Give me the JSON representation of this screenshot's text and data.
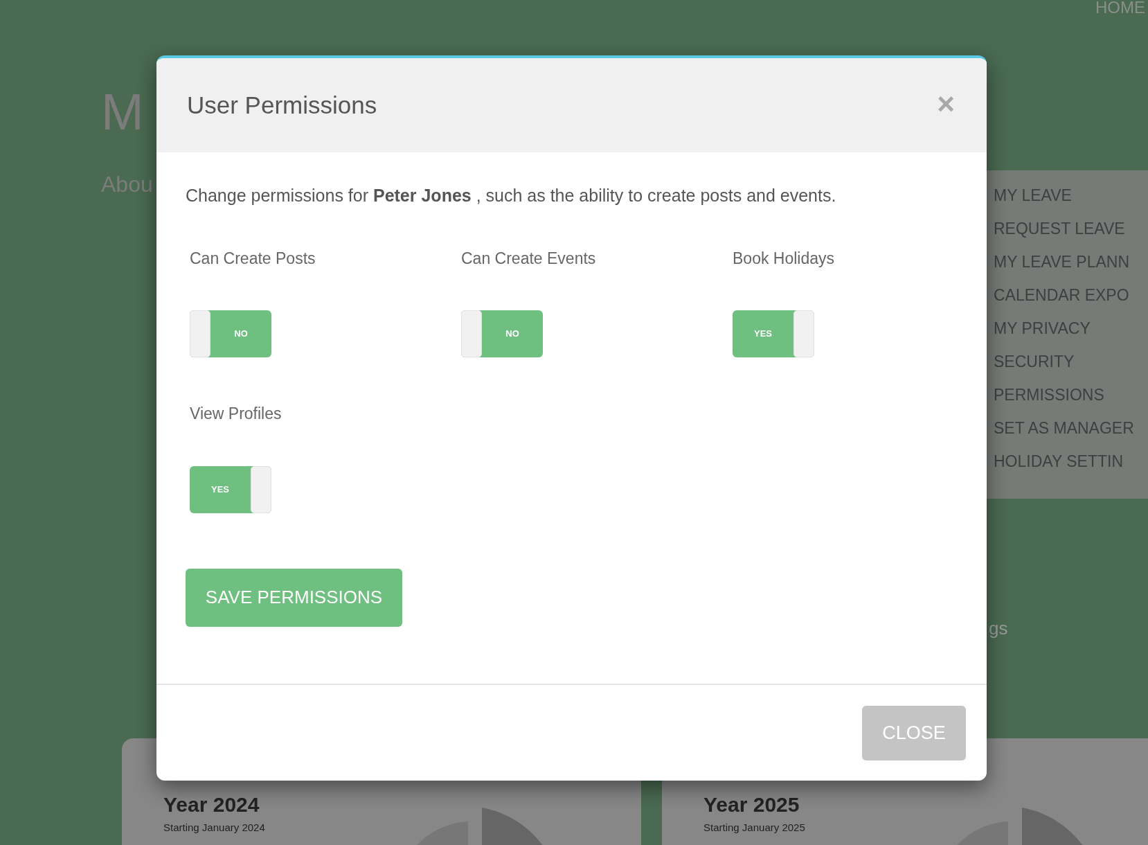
{
  "page": {
    "nav_link": "HOME",
    "heading": "M",
    "subheading": "Abou",
    "partial_text": "gs",
    "sidebar": {
      "items": [
        {
          "label": "MY LEAVE"
        },
        {
          "label": "REQUEST LEAVE"
        },
        {
          "label": "MY LEAVE PLANN"
        },
        {
          "label": "CALENDAR EXPO"
        },
        {
          "label": "MY PRIVACY"
        },
        {
          "label": "SECURITY"
        },
        {
          "label": "PERMISSIONS"
        },
        {
          "label": "SET AS MANAGER"
        },
        {
          "label": "HOLIDAY SETTIN"
        }
      ]
    },
    "cards": [
      {
        "title": "Year 2024",
        "subtitle": "Starting January 2024"
      },
      {
        "title": "Year 2025",
        "subtitle": "Starting January 2025"
      }
    ]
  },
  "modal": {
    "title": "User Permissions",
    "close_icon": "×",
    "description": "Change permissions for **Peter Jones** , such as the ability to create posts and events.",
    "permissions": [
      {
        "label": "Can Create Posts",
        "on": false,
        "text": "NO"
      },
      {
        "label": "Can Create Events",
        "on": false,
        "text": "NO"
      },
      {
        "label": "Book Holidays",
        "on": true,
        "text": "YES"
      },
      {
        "label": "View Profiles",
        "on": true,
        "text": "YES"
      }
    ],
    "save_button": "SAVE PERMISSIONS",
    "close_button": "CLOSE"
  }
}
